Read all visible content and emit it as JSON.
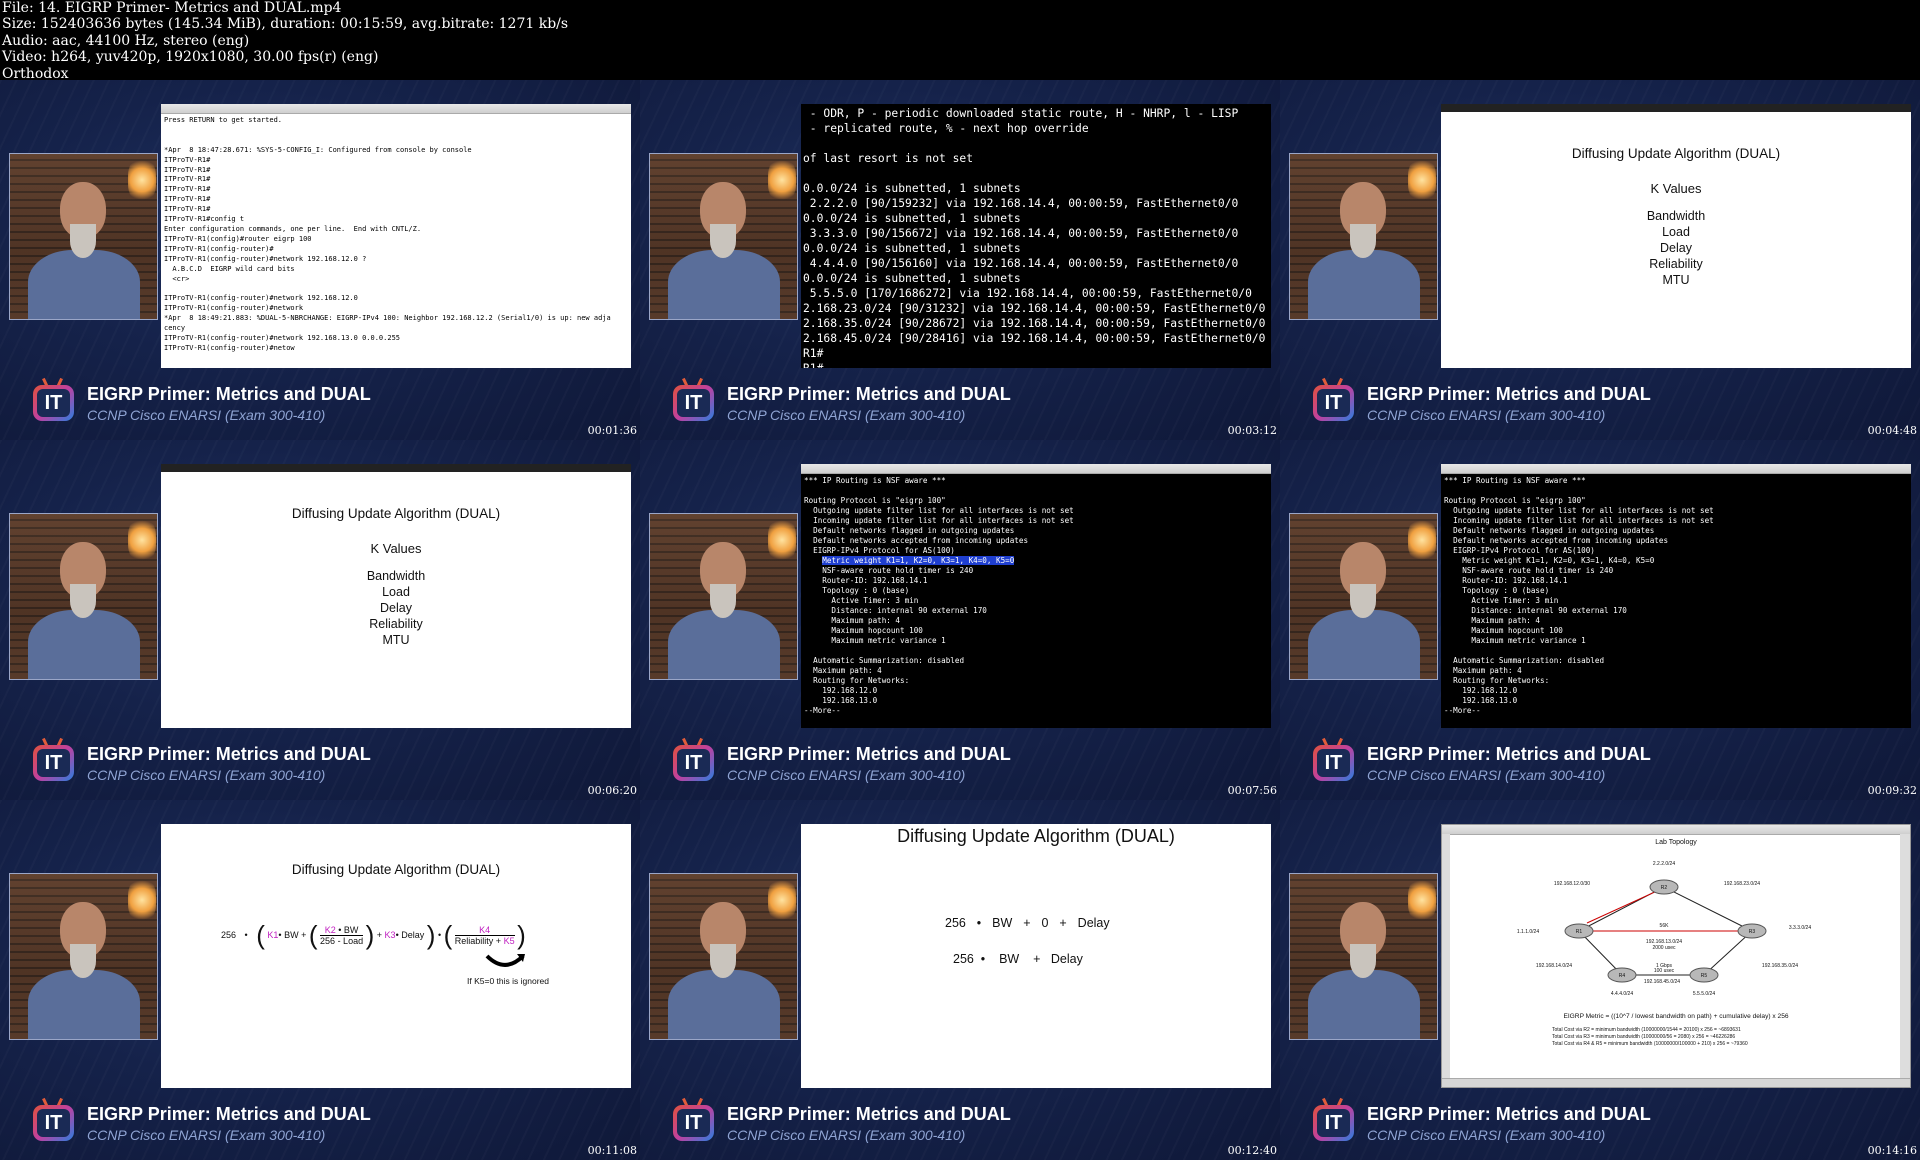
{
  "file_info": {
    "file": "File: 14. EIGRP Primer- Metrics and DUAL.mp4",
    "size": "Size: 152403636 bytes (145.34 MiB), duration: 00:15:59, avg.bitrate: 1271 kb/s",
    "audio": "Audio: aac, 44100 Hz, stereo (eng)",
    "video": "Video: h264, yuv420p, 1920x1080, 30.00 fps(r) (eng)",
    "author": "Orthodox"
  },
  "common": {
    "brand_text": "IT",
    "title": "EIGRP Primer:  Metrics and DUAL",
    "subtitle": "CCNP Cisco ENARSI (Exam 300-410)"
  },
  "frames": [
    {
      "timestamp": "00:01:36"
    },
    {
      "timestamp": "00:03:12"
    },
    {
      "timestamp": "00:04:48"
    },
    {
      "timestamp": "00:06:20"
    },
    {
      "timestamp": "00:07:56"
    },
    {
      "timestamp": "00:09:32"
    },
    {
      "timestamp": "00:11:08"
    },
    {
      "timestamp": "00:12:40"
    },
    {
      "timestamp": "00:14:16"
    }
  ],
  "terminal1": {
    "lines": [
      "Press RETURN to get started.",
      "",
      "",
      "*Apr  8 18:47:28.671: %SYS-5-CONFIG_I: Configured from console by console",
      "ITProTV-R1#",
      "ITProTV-R1#",
      "ITProTV-R1#",
      "ITProTV-R1#",
      "ITProTV-R1#",
      "ITProTV-R1#",
      "ITProTV-R1#config t",
      "Enter configuration commands, one per line.  End with CNTL/Z.",
      "ITProTV-R1(config)#router eigrp 100",
      "ITProTV-R1(config-router)#",
      "ITProTV-R1(config-router)#network 192.168.12.0 ?",
      "  A.B.C.D  EIGRP wild card bits",
      "  <cr>",
      "",
      "ITProTV-R1(config-router)#network 192.168.12.0",
      "ITProTV-R1(config-router)#network",
      "*Apr  8 18:49:21.883: %DUAL-5-NBRCHANGE: EIGRP-IPv4 100: Neighbor 192.168.12.2 (Serial1/0) is up: new adja",
      "cency",
      "ITProTV-R1(config-router)#network 192.168.13.0 0.0.0.255",
      "ITProTV-R1(config-router)#netow"
    ]
  },
  "terminal2": {
    "lines": [
      " - ODR, P - periodic downloaded static route, H - NHRP, l - LISP",
      " - replicated route, % - next hop override",
      "",
      "of last resort is not set",
      "",
      "0.0.0/24 is subnetted, 1 subnets",
      " 2.2.2.0 [90/159232] via 192.168.14.4, 00:00:59, FastEthernet0/0",
      "0.0.0/24 is subnetted, 1 subnets",
      " 3.3.3.0 [90/156672] via 192.168.14.4, 00:00:59, FastEthernet0/0",
      "0.0.0/24 is subnetted, 1 subnets",
      " 4.4.4.0 [90/156160] via 192.168.14.4, 00:00:59, FastEthernet0/0",
      "0.0.0/24 is subnetted, 1 subnets",
      " 5.5.5.0 [170/1686272] via 192.168.14.4, 00:00:59, FastEthernet0/0",
      "2.168.23.0/24 [90/31232] via 192.168.14.4, 00:00:59, FastEthernet0/0",
      "2.168.35.0/24 [90/28672] via 192.168.14.4, 00:00:59, FastEthernet0/0",
      "2.168.45.0/24 [90/28416] via 192.168.14.4, 00:00:59, FastEthernet0/0",
      "R1#",
      "R1#"
    ]
  },
  "dual_slide": {
    "heading": "Diffusing Update Algorithm (DUAL)",
    "k_values": "K  Values",
    "items": [
      "Bandwidth",
      "Load",
      "Delay",
      "Reliability",
      "MTU"
    ]
  },
  "terminal3": {
    "lines": [
      "*** IP Routing is NSF aware ***",
      "",
      "Routing Protocol is \"eigrp 100\"",
      "  Outgoing update filter list for all interfaces is not set",
      "  Incoming update filter list for all interfaces is not set",
      "  Default networks flagged in outgoing updates",
      "  Default networks accepted from incoming updates",
      "  EIGRP-IPv4 Protocol for AS(100)",
      "    Metric weight K1=1, K2=0, K3=1, K4=0, K5=0",
      "    NSF-aware route hold timer is 240",
      "    Router-ID: 192.168.14.1",
      "    Topology : 0 (base)",
      "      Active Timer: 3 min",
      "      Distance: internal 90 external 170",
      "      Maximum path: 4",
      "      Maximum hopcount 100",
      "      Maximum metric variance 1",
      "",
      "  Automatic Summarization: disabled",
      "  Maximum path: 4",
      "  Routing for Networks:",
      "    192.168.12.0",
      "    192.168.13.0",
      "--More--"
    ]
  },
  "formula_slide": {
    "heading": "Diffusing Update Algorithm (DUAL)",
    "const": "256",
    "k1": "K1",
    "k2": "K2",
    "k3": "K3",
    "k4": "K4",
    "k5": "K5",
    "bw": "BW",
    "load": "256 - Load",
    "delay": "Delay",
    "reliability": "Reliability",
    "note": "If K5=0 this is ignored"
  },
  "simplified_slide": {
    "heading": "Diffusing Update Algorithm (DUAL)",
    "row1": [
      "256",
      "BW",
      "+",
      "0",
      "+",
      "Delay"
    ],
    "row2": [
      "256",
      "BW",
      "+",
      "Delay"
    ]
  },
  "topology_slide": {
    "heading": "Lab Topology",
    "routers": [
      "R1",
      "R2",
      "R3",
      "R4",
      "R5"
    ],
    "labels": [
      "2.2.2.0/24",
      "192.168.12.0/30",
      "192.168.23.0/24",
      "1.1.1.0/24",
      "3.3.3.0/24",
      "192.168.13.0/24",
      "192.168.14.0/24",
      "192.168.35.0/24",
      "4.4.4.0/24",
      "192.168.45.0/24",
      "5.5.5.0/24",
      "56K",
      "2000 usec",
      "1 Gbps",
      "100 usec"
    ],
    "metric": "EIGRP Metric = ((10^7 / lowest bandwidth on path) + cumulative delay) x 256",
    "cost_lines": [
      "Total Cost via R2 = minimum bandwidth (10000000/1544 = 20100) x 256 = ~6893631",
      "Total Cost via R3 = minimum bandwidth (10000000/56 = 2080) x 256 = ~46226286",
      "Total Cost via R4 & R5 = minimum bandwidth (10000000/100000 + 210) x 256 = ~79360"
    ]
  }
}
